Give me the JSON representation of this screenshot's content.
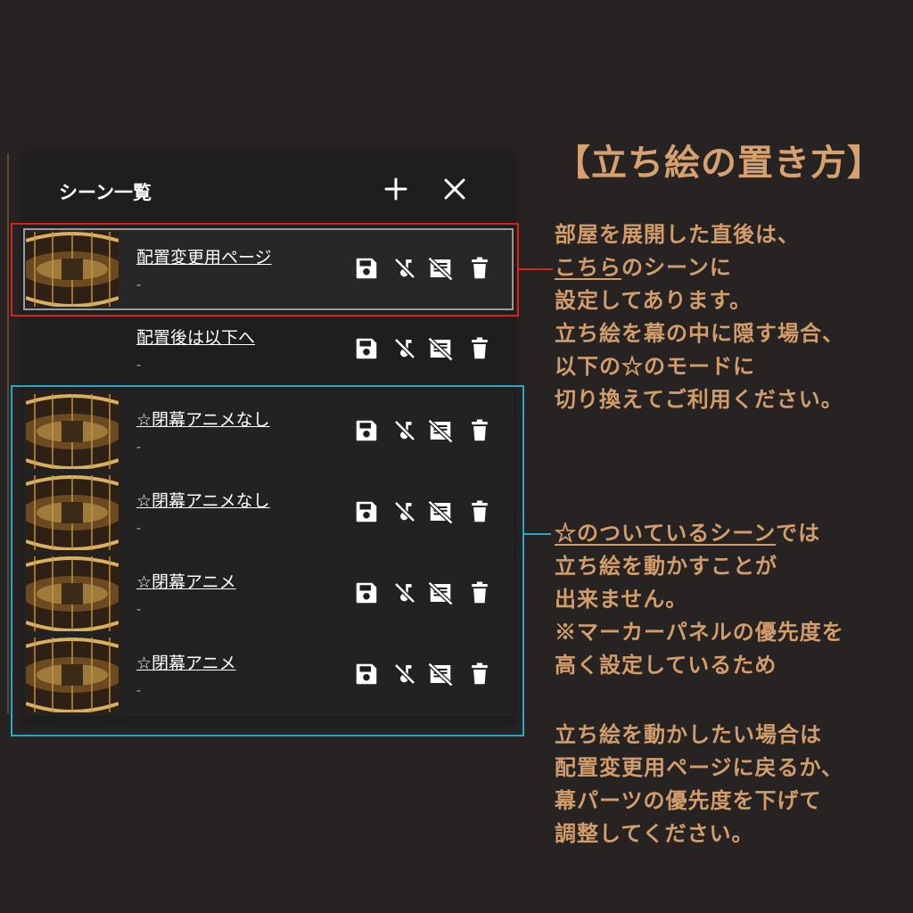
{
  "panel": {
    "title": "シーン一覧",
    "add_icon": "plus-icon",
    "close_icon": "close-icon",
    "scenes": [
      {
        "name": "配置変更用ページ",
        "sub": "-",
        "has_thumb": true
      },
      {
        "name": "配置後は以下へ",
        "sub": "-",
        "has_thumb": false
      },
      {
        "name": "☆閉幕アニメなし",
        "sub": "-",
        "has_thumb": true
      },
      {
        "name": "☆閉幕アニメなし",
        "sub": "-",
        "has_thumb": true
      },
      {
        "name": "☆閉幕アニメ",
        "sub": "-",
        "has_thumb": true
      },
      {
        "name": "☆閉幕アニメ",
        "sub": "-",
        "has_thumb": true
      }
    ],
    "row_icons": [
      "save-icon",
      "music-off-icon",
      "note-off-icon",
      "trash-icon"
    ]
  },
  "annotation": {
    "title": "【立ち絵の置き方】",
    "block1": {
      "line1": "部屋を展開した直後は、",
      "line2_link": "こちら",
      "line2_rest": "のシーンに",
      "line3": "設定してあります。",
      "line4": "立ち絵を幕の中に隠す場合、",
      "line5": "以下の☆のモードに",
      "line6": "切り換えてご利用ください。"
    },
    "block2": {
      "line1_link": "☆のついているシーン",
      "line1_rest": "では",
      "line2": "立ち絵を動かすことが",
      "line3": "出来ません。",
      "line4": "※マーカーパネルの優先度を",
      "line5": "高く設定しているため"
    },
    "block3": {
      "line1": "立ち絵を動かしたい場合は",
      "line2": "配置変更用ページに戻るか、",
      "line3": "幕パーツの優先度を下げて",
      "line4": "調整してください。"
    }
  },
  "colors": {
    "red_highlight": "#d6231f",
    "blue_highlight": "#2aa7c6",
    "text_accent": "#d29d6b"
  }
}
